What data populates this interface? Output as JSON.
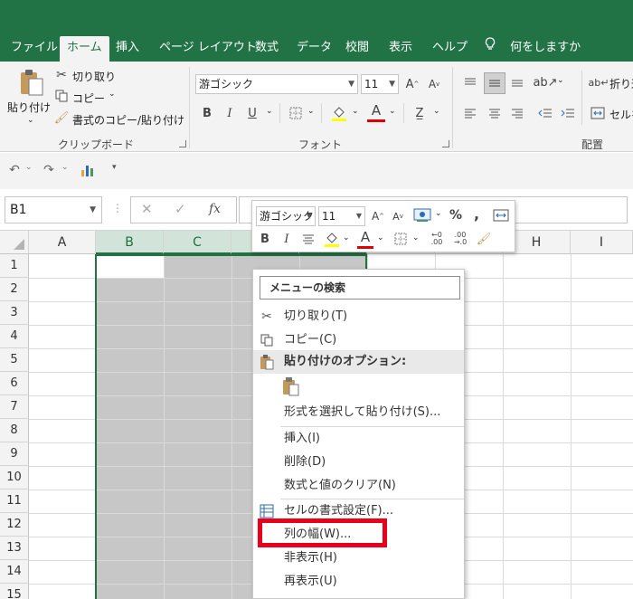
{
  "tabs": [
    "ファイル",
    "ホーム",
    "挿入",
    "ページ レイアウト",
    "数式",
    "データ",
    "校閲",
    "表示",
    "ヘルプ"
  ],
  "tell_me": "何をしますか",
  "ribbon": {
    "clipboard": {
      "paste": "貼り付け",
      "cut": "切り取り",
      "copy": "コピー",
      "format_painter": "書式のコピー/貼り付け",
      "label": "クリップボード"
    },
    "font": {
      "font_name": "游ゴシック",
      "font_size": "11",
      "bold": "B",
      "italic": "I",
      "underline": "U",
      "font_color_letter": "A",
      "label": "フォント"
    },
    "alignment": {
      "wrap": "折り返",
      "merge": "セルを",
      "label": "配置"
    }
  },
  "name_box": "B1",
  "fx": "fx",
  "columns": [
    "A",
    "B",
    "C",
    "",
    "",
    "",
    "H",
    "I"
  ],
  "rows": [
    "1",
    "2",
    "3",
    "4",
    "5",
    "6",
    "7",
    "8",
    "9",
    "10",
    "11",
    "12",
    "13",
    "14",
    "15"
  ],
  "mini_toolbar": {
    "font_name": "游ゴシック",
    "font_size": "11",
    "percent": "%",
    "comma": ",",
    "bold": "B",
    "italic": "I",
    "font_color_letter": "A"
  },
  "context_menu": {
    "search": "メニューの検索",
    "cut": "切り取り(T)",
    "copy": "コピー(C)",
    "paste_options": "貼り付けのオプション:",
    "paste_special": "形式を選択して貼り付け(S)...",
    "insert": "挿入(I)",
    "delete": "削除(D)",
    "clear": "数式と値のクリア(N)",
    "format_cells": "セルの書式設定(F)...",
    "column_width": "列の幅(W)...",
    "hide": "非表示(H)",
    "unhide": "再表示(U)"
  },
  "colors": {
    "excel_green": "#217346",
    "highlight_red": "#e8001c",
    "selection_gray": "#c7c7c7"
  }
}
